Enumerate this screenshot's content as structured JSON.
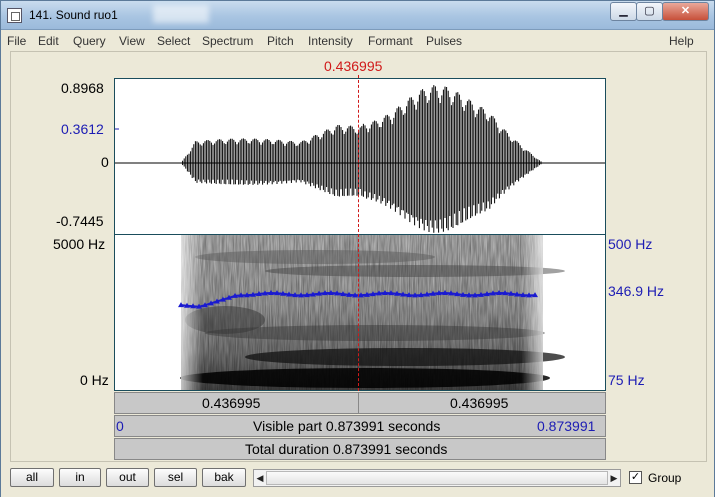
{
  "window": {
    "title": "141. Sound ruo1"
  },
  "menu": [
    "File",
    "Edit",
    "Query",
    "View",
    "Select",
    "Spectrum",
    "Pitch",
    "Intensity",
    "Formant",
    "Pulses",
    "Help"
  ],
  "cursor": {
    "time": "0.436995"
  },
  "waveform": {
    "y_max": "0.8968",
    "y_cursor": "0.3612",
    "y_zero": "0",
    "y_min": "-0.7445"
  },
  "spectrogram": {
    "freq_top": "5000 Hz",
    "freq_bottom": "0 Hz",
    "pitch_top": "500 Hz",
    "pitch_current": "346.9 Hz",
    "pitch_bottom": "75 Hz",
    "pitch_level_hz": 346.9
  },
  "time_bars": {
    "left_interval": "0.436995",
    "right_interval": "0.436995",
    "window_start": "0",
    "visible_part": "Visible part 0.873991 seconds",
    "window_end": "0.873991",
    "total_duration": "Total duration 0.873991 seconds"
  },
  "bottom_buttons": {
    "all": "all",
    "in": "in",
    "out": "out",
    "sel": "sel",
    "bak": "bak"
  },
  "group_checkbox": {
    "label": "Group",
    "checked": true
  },
  "icons": [
    "app-icon",
    "minimize-icon",
    "maximize-icon",
    "close-icon",
    "scroll-left-icon",
    "scroll-right-icon",
    "checkmark-icon"
  ]
}
